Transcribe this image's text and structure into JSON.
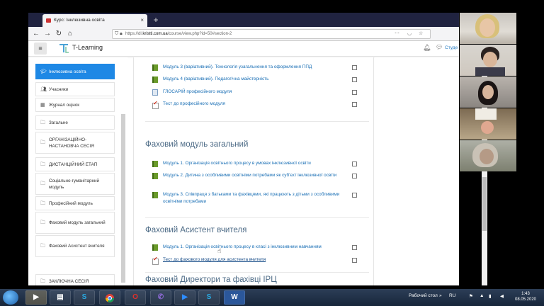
{
  "browser": {
    "tab_title": "Курс: Інклюзивна освіта",
    "tab_close": "×",
    "new_tab": "+",
    "url_prefix": "https://dl.",
    "url_host": "kristti.com.ua",
    "url_path": "/course/view.php?id=50#section-2"
  },
  "header": {
    "brand": "T-Learning",
    "user_label": "Студе"
  },
  "sidebar": {
    "items": [
      {
        "label": "Інклюзивна освіта",
        "icon": "graduation-cap-icon"
      },
      {
        "label": "Учасники",
        "icon": "users-icon"
      },
      {
        "label": "Журнал оцінок",
        "icon": "table-icon"
      },
      {
        "label": "Загальне",
        "icon": "folder-icon"
      },
      {
        "label": "ОРГАНІЗАЦІЙНО-НАСТАНОВЧА СЕСІЯ",
        "icon": "folder-icon"
      },
      {
        "label": "ДИСТАНЦІЙНИЙ ЕТАП",
        "icon": "folder-icon"
      },
      {
        "label": "Соціально-гуманітарний модуль",
        "icon": "folder-icon"
      },
      {
        "label": "Професійний модуль",
        "icon": "folder-icon"
      },
      {
        "label": "Фаховий модуль загальний",
        "icon": "folder-icon"
      },
      {
        "label": "Фаховий Асистент вчителя",
        "icon": "folder-icon"
      },
      {
        "label": "ЗАКЛЮЧНА СЕСІЯ",
        "icon": "folder-icon"
      }
    ]
  },
  "course": {
    "top_activities": [
      {
        "label": "Модуль 3 (варіативний). Технологія узагальнення та оформлення ППД",
        "icon": "book-icon"
      },
      {
        "label": "Модуль 4 (варіативний). Педагогічна майстерність",
        "icon": "book-icon"
      },
      {
        "label": "ГЛОСАРІЙ професійного модуля",
        "icon": "glossary-icon"
      },
      {
        "label": "Тест до професійного модуля",
        "icon": "quiz-icon"
      }
    ],
    "section1_title": "Фаховий модуль загальний",
    "section1_activities": [
      {
        "label": "Модуль 1. Організація освітнього процесу в умовах інклюзивної освіти",
        "icon": "book-icon"
      },
      {
        "label": "Модуль 2. Дитина з особливими освітніми потребами як суб'єкт інклюзивної освіти",
        "icon": "book-icon"
      },
      {
        "label": " Модуль 3. Співпраця з батьками та фахівцями, які працюють з дітьми з особливими освітніми потребами",
        "icon": "book-icon"
      }
    ],
    "section2_title": "Фаховий Асистент вчителя",
    "section2_activities": [
      {
        "label": "Модуль 1. Організація освітнього процесу в класі з інклюзивним навчанням",
        "icon": "book-icon"
      },
      {
        "label": "Тест до фахового модуля для асистента вчителя",
        "icon": "quiz-icon"
      }
    ],
    "section3_title": "Фаховий Директори та фахівці ІРЦ"
  },
  "taskbar": {
    "lang": "RU",
    "desktop_label": "Рабочий стол",
    "time": "1:43",
    "date": "08.05.2020",
    "apps": [
      "explorer-icon",
      "files-icon",
      "skype-icon",
      "chrome-icon",
      "opera-icon",
      "viber-icon",
      "zoom-icon",
      "skype-icon",
      "word-icon"
    ],
    "word_letter": "W",
    "skype_letter": "S"
  },
  "colors": {
    "active_nav": "#1e88e5",
    "link": "#1a6fb5",
    "section_title": "#4d6b86",
    "tab_bar": "#202340"
  }
}
